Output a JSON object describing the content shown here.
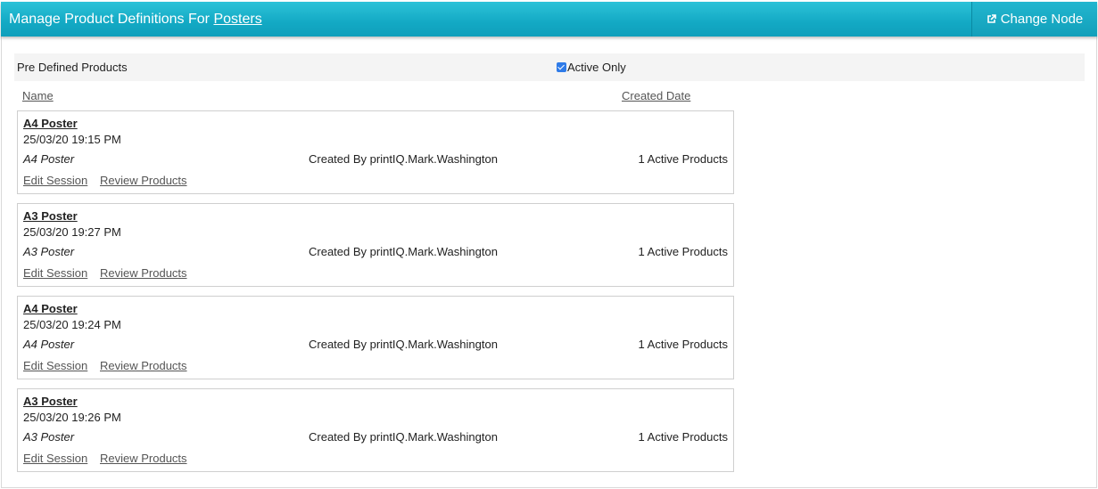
{
  "header": {
    "title_prefix": "Manage Product Definitions For ",
    "node_name": "Posters",
    "change_node_label": "Change Node",
    "change_node_icon": "external-link-icon",
    "background_color": "#13a9c4"
  },
  "filter": {
    "label": "Pre Defined Products",
    "active_only_label": "Active Only",
    "active_only_checked": true
  },
  "columns": {
    "name": "Name",
    "created_date": "Created Date"
  },
  "products": [
    {
      "title": "A4 Poster",
      "date": "25/03/20 19:15 PM",
      "description": "A4 Poster",
      "created_by": "Created By printIQ.Mark.Washington",
      "count": "1 Active Products",
      "edit_label": "Edit Session",
      "review_label": "Review Products"
    },
    {
      "title": "A3 Poster",
      "date": "25/03/20 19:27 PM",
      "description": "A3 Poster",
      "created_by": "Created By printIQ.Mark.Washington",
      "count": "1 Active Products",
      "edit_label": "Edit Session",
      "review_label": "Review Products"
    },
    {
      "title": "A4 Poster",
      "date": "25/03/20 19:24 PM",
      "description": "A4 Poster",
      "created_by": "Created By printIQ.Mark.Washington",
      "count": "1 Active Products",
      "edit_label": "Edit Session",
      "review_label": "Review Products"
    },
    {
      "title": "A3 Poster",
      "date": "25/03/20 19:26 PM",
      "description": "A3 Poster",
      "created_by": "Created By printIQ.Mark.Washington",
      "count": "1 Active Products",
      "edit_label": "Edit Session",
      "review_label": "Review Products"
    }
  ]
}
